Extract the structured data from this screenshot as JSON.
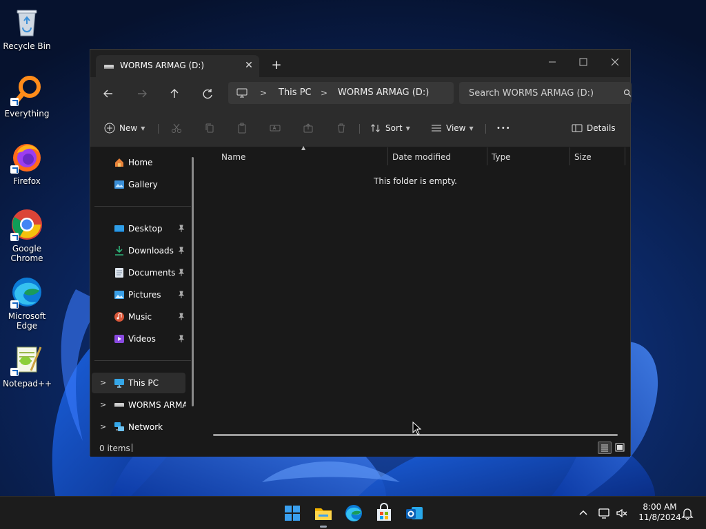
{
  "desktop": {
    "icons": [
      {
        "label": "Recycle Bin",
        "icon": "recycle-bin-icon"
      },
      {
        "label": "Everything",
        "icon": "everything-search-icon"
      },
      {
        "label": "Firefox",
        "icon": "firefox-icon"
      },
      {
        "label": "Google Chrome",
        "icon": "chrome-icon"
      },
      {
        "label": "Microsoft Edge",
        "icon": "edge-icon"
      },
      {
        "label": "Notepad++",
        "icon": "notepad-plus-plus-icon"
      }
    ]
  },
  "explorer": {
    "tab_title": "WORMS ARMAG (D:)",
    "new_tab": "+",
    "address": {
      "crumbs": [
        "This PC",
        "WORMS ARMAG (D:)"
      ]
    },
    "search_placeholder": "Search WORMS ARMAG (D:)",
    "commands": {
      "new": "New",
      "sort": "Sort",
      "view": "View",
      "more": "•••",
      "details": "Details"
    },
    "nav": {
      "home": "Home",
      "gallery": "Gallery",
      "quick_access": [
        "Desktop",
        "Downloads",
        "Documents",
        "Pictures",
        "Music",
        "Videos"
      ],
      "this_pc": "This PC",
      "drive": "WORMS ARMAG",
      "network": "Network"
    },
    "columns": [
      "Name",
      "Date modified",
      "Type",
      "Size"
    ],
    "empty_message": "This folder is empty.",
    "status": {
      "item_count": "0 items"
    }
  },
  "taskbar": {
    "apps": [
      "start-icon",
      "file-explorer-icon",
      "edge-icon",
      "store-icon",
      "outlook-icon"
    ],
    "time": "8:00 AM",
    "date": "11/8/2024"
  },
  "colors": {
    "window_bg": "#191919",
    "toolbar_bg": "#2c2c2c",
    "taskbar_bg": "#1c1c1c",
    "accent": "#0078d4"
  }
}
